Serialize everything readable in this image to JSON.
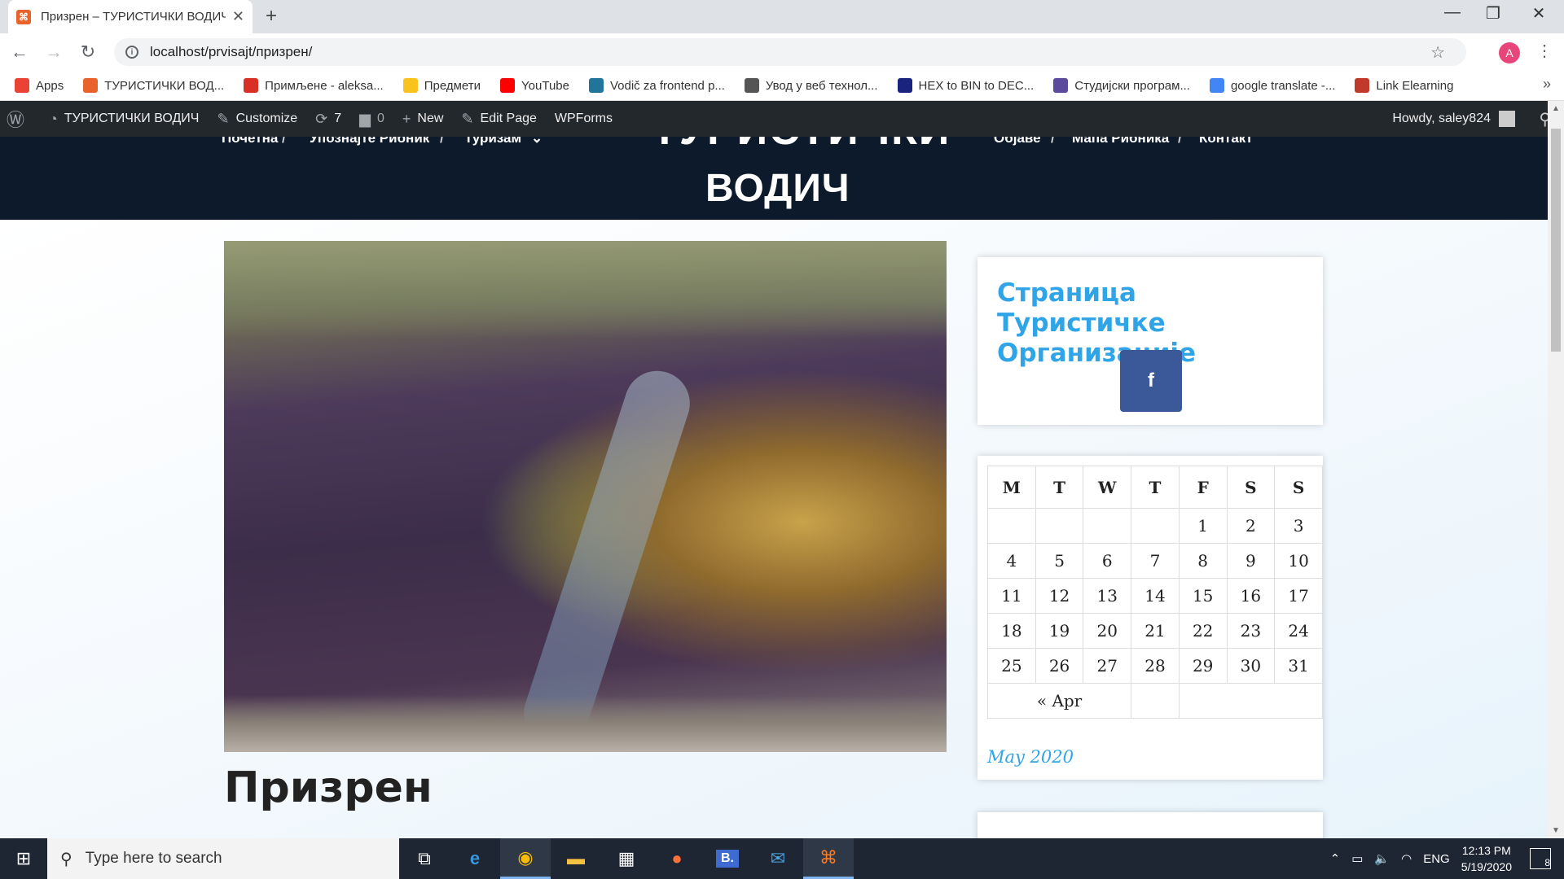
{
  "browser": {
    "tab_title": "Призрен – ТУРИСТИЧКИ ВОДИЧ",
    "url": "localhost/prvisajt/призрен/",
    "profile_initial": "A"
  },
  "bookmarks": [
    {
      "label": "Apps",
      "icon": "apps-grid-icon",
      "color": "#ea4335"
    },
    {
      "label": "ТУРИСТИЧКИ ВОД...",
      "icon": "xampp-icon",
      "color": "#e8632b"
    },
    {
      "label": "Примљене - aleksa...",
      "icon": "gmail-icon",
      "color": "#d93025"
    },
    {
      "label": "Предмети",
      "icon": "moodle-icon",
      "color": "#f9c21c"
    },
    {
      "label": "YouTube",
      "icon": "youtube-icon",
      "color": "#ff0000"
    },
    {
      "label": "Vodič za frontend p...",
      "icon": "wordpress-icon",
      "color": "#21759b"
    },
    {
      "label": "Увод у веб технол...",
      "icon": "globe-icon",
      "color": "#555555"
    },
    {
      "label": "HEX to BIN to DEC...",
      "icon": "converter-icon",
      "color": "#1a237e"
    },
    {
      "label": "Студијски програм...",
      "icon": "university-icon",
      "color": "#5c4a9c"
    },
    {
      "label": "google translate -...",
      "icon": "google-icon",
      "color": "#4285f4"
    },
    {
      "label": "Link Elearning",
      "icon": "elearning-icon",
      "color": "#c0392b"
    }
  ],
  "adminbar": {
    "site_name": "ТУРИСТИЧКИ ВОДИЧ",
    "customize": "Customize",
    "updates": "7",
    "comments": "0",
    "new": "New",
    "edit_page": "Edit Page",
    "wpforms": "WPForms",
    "howdy": "Howdy, saley824"
  },
  "site": {
    "title_line1": "ТУРИСТИЧКИ",
    "title_line2": "ВОДИЧ",
    "nav": [
      "Почетна",
      "Упознајте Рибник",
      "Туризам",
      "Објаве",
      "Мапа Рибника",
      "Контакт"
    ]
  },
  "page": {
    "title": "Призрен"
  },
  "widgets": {
    "facebook_title": "Страница Туристичке Организације",
    "facebook_icon": "f",
    "calendar": {
      "headers": [
        "M",
        "T",
        "W",
        "T",
        "F",
        "S",
        "S"
      ],
      "rows": [
        [
          "",
          "",
          "",
          "",
          "1",
          "2",
          "3"
        ],
        [
          "4",
          "5",
          "6",
          "7",
          "8",
          "9",
          "10"
        ],
        [
          "11",
          "12",
          "13",
          "14",
          "15",
          "16",
          "17"
        ],
        [
          "18",
          "19",
          "20",
          "21",
          "22",
          "23",
          "24"
        ],
        [
          "25",
          "26",
          "27",
          "28",
          "29",
          "30",
          "31"
        ]
      ],
      "prev_link": "« Apr",
      "caption": "May 2020"
    }
  },
  "taskbar": {
    "search_placeholder": "Type here to search",
    "lang": "ENG",
    "time": "12:13 PM",
    "date": "5/19/2020",
    "notifications": "8"
  }
}
